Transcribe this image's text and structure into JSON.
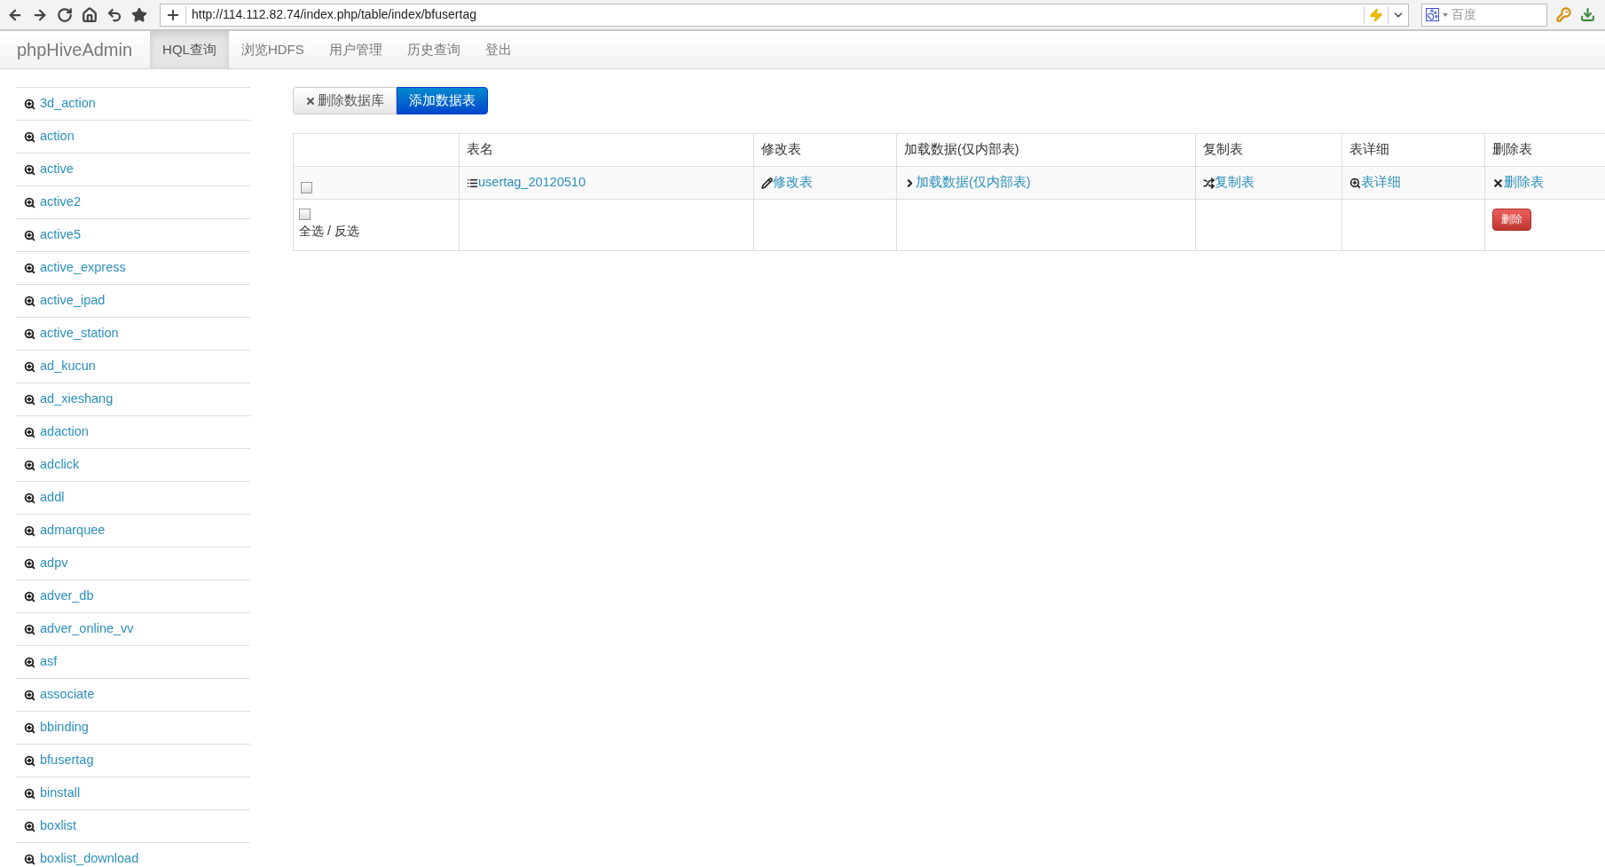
{
  "browser": {
    "url": "http://114.112.82.74/index.php/table/index/bfusertag",
    "search_placeholder": "百度"
  },
  "navbar": {
    "brand": "phpHiveAdmin",
    "items": [
      {
        "label": "HQL查询",
        "selected": true
      },
      {
        "label": "浏览HDFS",
        "selected": false
      },
      {
        "label": "用户管理",
        "selected": false
      },
      {
        "label": "历史查询",
        "selected": false
      },
      {
        "label": "登出",
        "selected": false
      }
    ]
  },
  "sidebar": {
    "items": [
      "3d_action",
      "action",
      "active",
      "active2",
      "active5",
      "active_express",
      "active_ipad",
      "active_station",
      "ad_kucun",
      "ad_xieshang",
      "adaction",
      "adclick",
      "addl",
      "admarquee",
      "adpv",
      "adver_db",
      "adver_online_vv",
      "asf",
      "associate",
      "bbinding",
      "bfusertag",
      "binstall",
      "boxlist",
      "boxlist_download"
    ]
  },
  "toolbar": [
    {
      "kind": "default",
      "label": "删除数据库"
    },
    {
      "kind": "primary",
      "label": "添加数据表"
    }
  ],
  "table": {
    "columns": [
      "表名",
      "修改表",
      "加载数据(仅内部表)",
      "复制表",
      "表详细",
      "删除表"
    ],
    "rows": [
      {
        "checked": false,
        "cells": [
          {
            "kind": "list",
            "text": "usertag_20120510"
          },
          {
            "kind": "pencil",
            "text": "修改表"
          },
          {
            "kind": "chevron",
            "text": "加载数据(仅内部表)"
          },
          {
            "kind": "shuffle",
            "text": "复制表"
          },
          {
            "kind": "zoom",
            "text": "表详细"
          },
          {
            "kind": "remove",
            "text": "删除表"
          }
        ]
      }
    ],
    "footer": {
      "checked": false,
      "label": "全选 / 反选",
      "button": "删除"
    }
  }
}
